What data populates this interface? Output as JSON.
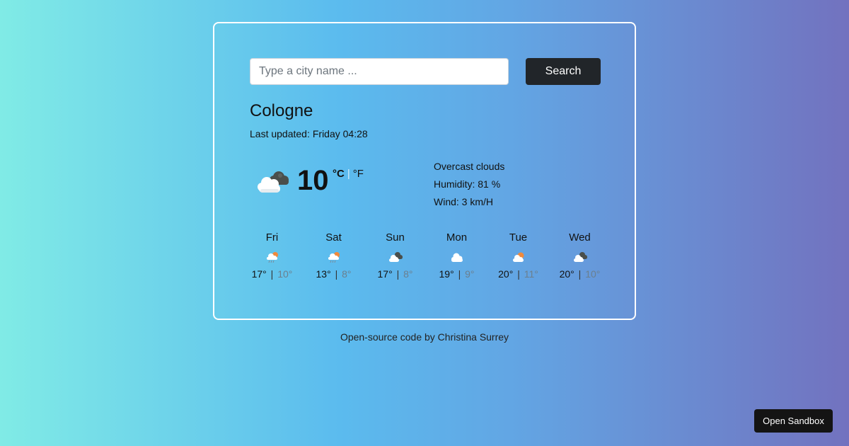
{
  "search": {
    "placeholder": "Type a city name ...",
    "value": "",
    "button_label": "Search"
  },
  "current": {
    "city": "Cologne",
    "last_updated_label": "Last updated:",
    "last_updated_value": "Friday 04:28",
    "icon": "overcast-clouds-icon",
    "temperature": "10",
    "unit_celsius": "°C",
    "unit_separator": "|",
    "unit_fahrenheit": "°F",
    "description": "Overcast clouds",
    "humidity": "Humidity: 81 %",
    "wind": "Wind: 3 km/H"
  },
  "forecast": [
    {
      "day": "Fri",
      "icon": "rain-sun-icon",
      "max": "17°",
      "min": "10°"
    },
    {
      "day": "Sat",
      "icon": "rain-sun-icon",
      "max": "13°",
      "min": "8°"
    },
    {
      "day": "Sun",
      "icon": "broken-clouds-icon",
      "max": "17°",
      "min": "8°"
    },
    {
      "day": "Mon",
      "icon": "cloud-icon",
      "max": "19°",
      "min": "9°"
    },
    {
      "day": "Tue",
      "icon": "partly-cloudy-icon",
      "max": "20°",
      "min": "11°"
    },
    {
      "day": "Wed",
      "icon": "broken-clouds-icon",
      "max": "20°",
      "min": "10°"
    }
  ],
  "temp_separator": "|",
  "footer": "Open-source code by Christina Surrey",
  "sandbox_button": "Open Sandbox",
  "colors": {
    "card_border": "#ffffff",
    "button_bg": "#212529",
    "min_temp": "#6b7f8e"
  }
}
